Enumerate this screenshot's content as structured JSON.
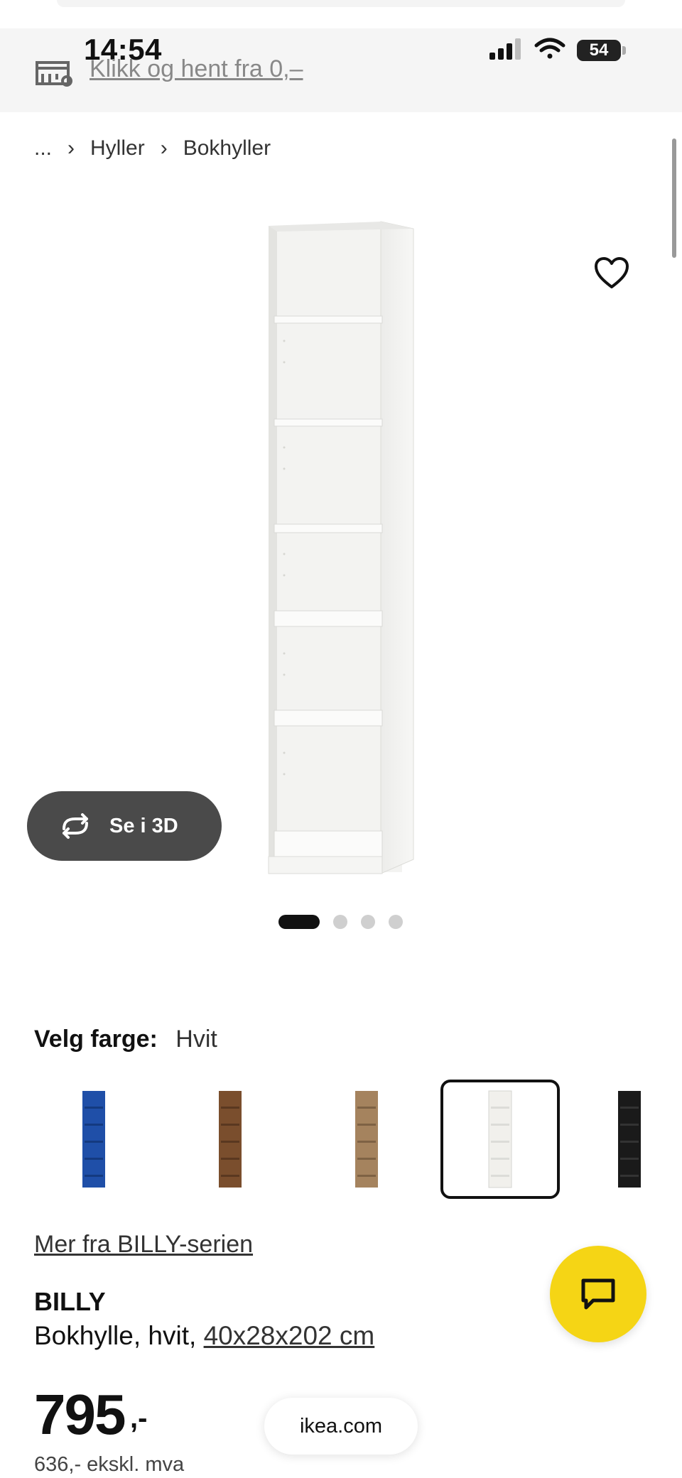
{
  "status_bar": {
    "time": "14:54",
    "battery": "54"
  },
  "pickup": {
    "link_text": "Klikk og hent fra 0,–"
  },
  "breadcrumb": {
    "ellipsis": "...",
    "items": [
      "Hyller",
      "Bokhyller"
    ]
  },
  "product_actions": {
    "view_3d_label": "Se i 3D"
  },
  "gallery": {
    "page_count": 4,
    "active_index": 0
  },
  "color_picker": {
    "label": "Velg farge:",
    "selected": "Hvit",
    "swatches": [
      {
        "color": "#1f4fa8"
      },
      {
        "color": "#7a4e2d"
      },
      {
        "color": "#a5835e"
      },
      {
        "color": "#f1f0ec"
      },
      {
        "color": "#1a1a1a"
      }
    ],
    "selected_index": 3
  },
  "product": {
    "series_link": "Mer fra BILLY-serien",
    "name": "BILLY",
    "description": "Bokhylle, hvit, ",
    "dimensions": "40x28x202 cm",
    "price": "795",
    "price_suffix": ",-",
    "price_ex_vat": "636,- ekskl. mva"
  },
  "browser": {
    "url": "ikea.com"
  },
  "colors": {
    "accent_yellow": "#f5d515",
    "dark_button": "#4a4a4a"
  }
}
